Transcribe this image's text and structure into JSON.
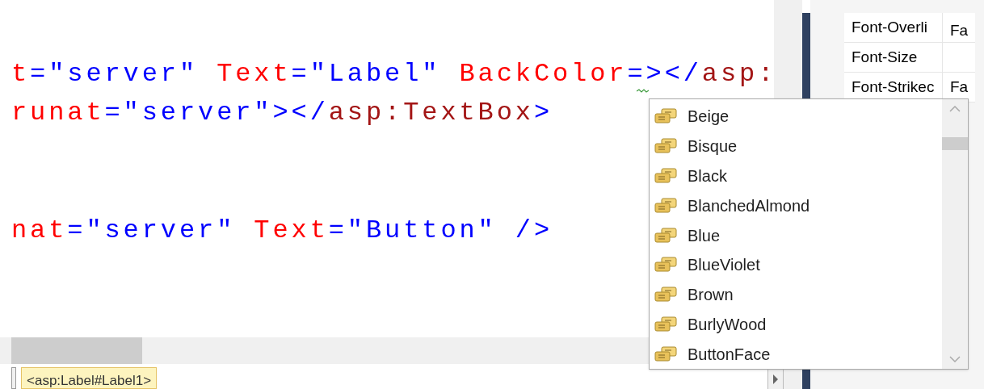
{
  "code_lines": [
    {
      "segments": [
        {
          "kind": "attr",
          "text": "t"
        },
        {
          "kind": "punct",
          "text": "=\"server\" "
        },
        {
          "kind": "attr",
          "text": "Text"
        },
        {
          "kind": "punct",
          "text": "=\"Label\" "
        },
        {
          "kind": "attr",
          "text": "BackColor"
        },
        {
          "kind": "punct",
          "text": "=></"
        },
        {
          "kind": "tag",
          "text": "asp:"
        }
      ],
      "squiggle": true
    },
    {
      "segments": [
        {
          "kind": "attr",
          "text": "runat"
        },
        {
          "kind": "punct",
          "text": "=\"server\"></"
        },
        {
          "kind": "tag",
          "text": "asp:TextBox"
        },
        {
          "kind": "punct",
          "text": ">"
        }
      ],
      "squiggle": false
    },
    {
      "segments": [
        {
          "kind": "attr",
          "text": "nat"
        },
        {
          "kind": "punct",
          "text": "=\"server\" "
        },
        {
          "kind": "attr",
          "text": "Text"
        },
        {
          "kind": "punct",
          "text": "=\"Button\" />"
        }
      ],
      "squiggle": false
    }
  ],
  "properties": [
    {
      "name": "Font-Overli",
      "value": "Fa"
    },
    {
      "name": "Font-Size"
    },
    {
      "name": "Font-Strikec",
      "value": "Fa"
    }
  ],
  "completion": {
    "items": [
      {
        "label": "Beige",
        "selected": false
      },
      {
        "label": "Bisque",
        "selected": false
      },
      {
        "label": "Black",
        "selected": false
      },
      {
        "label": "BlanchedAlmond",
        "selected": false
      },
      {
        "label": "Blue",
        "selected": false
      },
      {
        "label": "BlueViolet",
        "selected": false
      },
      {
        "label": "Brown",
        "selected": false
      },
      {
        "label": "BurlyWood",
        "selected": false
      },
      {
        "label": "ButtonFace",
        "selected": false
      }
    ]
  },
  "breadcrumb": "<asp:Label#Label1>"
}
